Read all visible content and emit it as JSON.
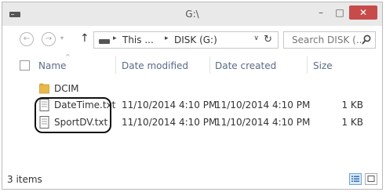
{
  "window": {
    "title": "G:\\",
    "controls": {
      "minimize": "–",
      "maximize": "□",
      "close": "✕"
    }
  },
  "toolbar": {
    "back_icon": "←",
    "forward_icon": "→",
    "recent_icon": "▾",
    "up_icon": "↑",
    "breadcrumbs": [
      "This ...",
      "DISK (G:)"
    ],
    "crumb_separator": "▸",
    "address_dropdown_icon": "∨",
    "refresh_icon": "↻",
    "search_placeholder": "Search DISK (..."
  },
  "columns": {
    "name": "Name",
    "date_modified": "Date modified",
    "date_created": "Date created",
    "size": "Size",
    "sort_indicator": "^"
  },
  "files": [
    {
      "name": "DCIM",
      "type": "folder",
      "date_modified": "",
      "date_created": "",
      "size": ""
    },
    {
      "name": "DateTime.txt",
      "type": "text-file",
      "date_modified": "11/10/2014 4:10 PM",
      "date_created": "11/10/2014 4:10 PM",
      "size": "1 KB"
    },
    {
      "name": "SportDV.txt",
      "type": "text-file",
      "date_modified": "11/10/2014 4:10 PM",
      "date_created": "11/10/2014 4:10 PM",
      "size": "1 KB"
    }
  ],
  "status": {
    "item_count": "3 items"
  },
  "colors": {
    "titlebar": "#e9e9e9",
    "close_button": "#c74b4b",
    "column_header_text": "#5a6b86",
    "folder": "#e8b84a",
    "selected_view": "#d7e9fa"
  }
}
